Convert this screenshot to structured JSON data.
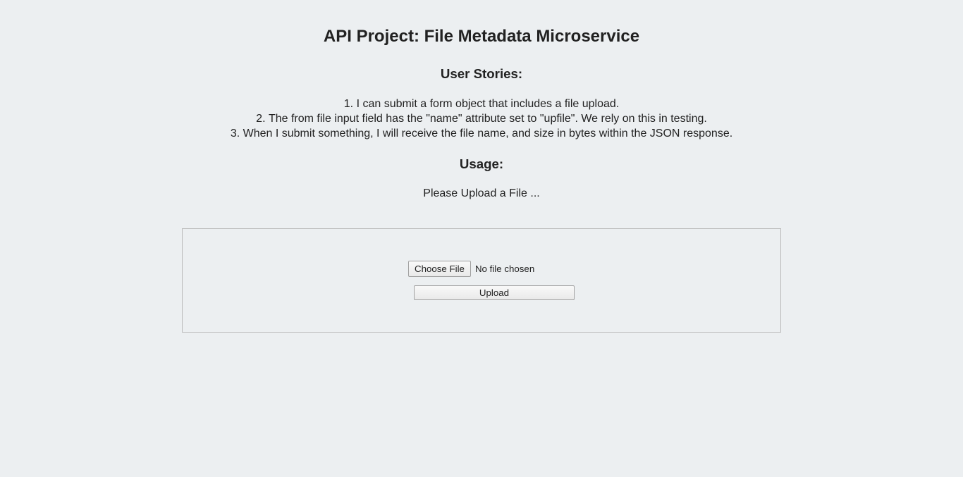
{
  "header": {
    "title": "API Project: File Metadata Microservice"
  },
  "sections": {
    "user_stories": {
      "heading": "User Stories:",
      "items": [
        "I can submit a form object that includes a file upload.",
        "The from file input field has the \"name\" attribute set to \"upfile\". We rely on this in testing.",
        "When I submit something, I will receive the file name, and size in bytes within the JSON response."
      ]
    },
    "usage": {
      "heading": "Usage:",
      "text": "Please Upload a File ..."
    }
  },
  "form": {
    "choose_file_label": "Choose File",
    "file_status": "No file chosen",
    "upload_label": "Upload"
  }
}
